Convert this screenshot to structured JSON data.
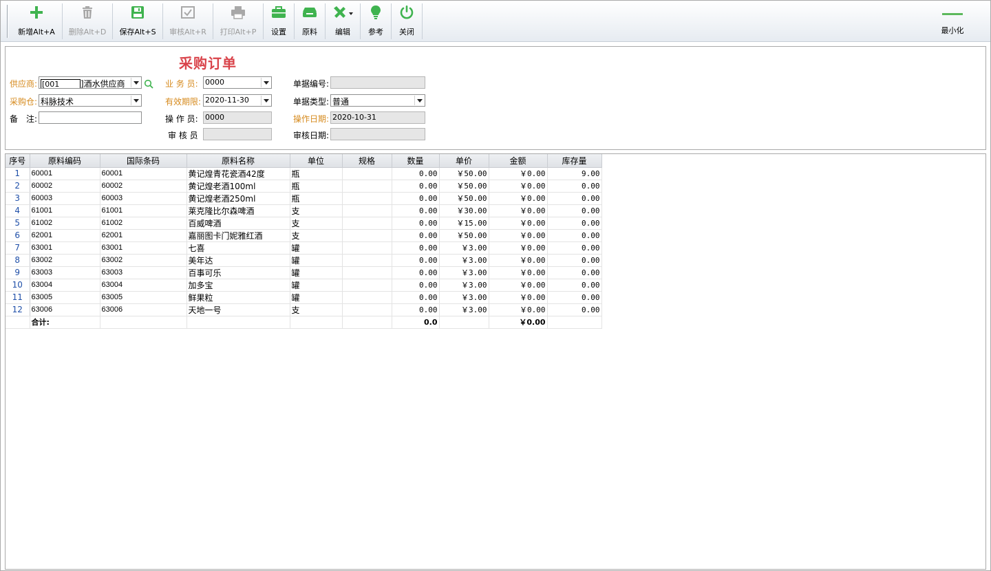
{
  "toolbar": {
    "buttons": [
      {
        "label": "新增Alt+A",
        "icon": "plus-icon",
        "enabled": true
      },
      {
        "label": "删除Alt+D",
        "icon": "trash-icon",
        "enabled": false
      },
      {
        "label": "保存Alt+S",
        "icon": "save-icon",
        "enabled": true
      },
      {
        "label": "审核Alt+R",
        "icon": "approve-icon",
        "enabled": false
      },
      {
        "label": "打印Alt+P",
        "icon": "printer-icon",
        "enabled": false
      },
      {
        "label": "设置",
        "icon": "briefcase-icon",
        "enabled": true
      },
      {
        "label": "原料",
        "icon": "material-icon",
        "enabled": true
      },
      {
        "label": "编辑",
        "icon": "tools-icon",
        "enabled": true
      },
      {
        "label": "参考",
        "icon": "lightbulb-icon",
        "enabled": true
      },
      {
        "label": "关闭",
        "icon": "power-icon",
        "enabled": true
      }
    ],
    "minimize_label": "最小化",
    "icon_color": "#3fb34f"
  },
  "form": {
    "title": "采购订单",
    "supplier": {
      "label": "供应商:",
      "code": "[001",
      "name": "]酒水供应商"
    },
    "warehouse": {
      "label": "采购仓:",
      "value": "科脉技术"
    },
    "remark": {
      "label": "备　注:",
      "value": ""
    },
    "salesman": {
      "label": "业 务 员:",
      "value": "0000"
    },
    "valid_until": {
      "label": "有效期限:",
      "value": "2020-11-30"
    },
    "operator": {
      "label": "操 作 员:",
      "value": "0000"
    },
    "auditor": {
      "label": "审 核 员",
      "value": ""
    },
    "doc_no": {
      "label": "单据编号:",
      "value": ""
    },
    "doc_type": {
      "label": "单据类型:",
      "value": "普通"
    },
    "op_date": {
      "label": "操作日期:",
      "value": "2020-10-31"
    },
    "audit_date": {
      "label": "审核日期:",
      "value": ""
    },
    "required_color": "#d68a1d",
    "title_color": "#d9434a"
  },
  "grid": {
    "columns": [
      "序号",
      "原料编码",
      "国际条码",
      "原料名称",
      "单位",
      "规格",
      "数量",
      "单价",
      "金额",
      "库存量"
    ],
    "rows": [
      {
        "seq": "1",
        "code": "60001",
        "barcode": "60001",
        "name": "黄记煌青花瓷酒42度",
        "unit": "瓶",
        "spec": "",
        "qty": "0.00",
        "price": "￥50.00",
        "amount": "￥0.00",
        "stock": "9.00"
      },
      {
        "seq": "2",
        "code": "60002",
        "barcode": "60002",
        "name": "黄记煌老酒100ml",
        "unit": "瓶",
        "spec": "",
        "qty": "0.00",
        "price": "￥50.00",
        "amount": "￥0.00",
        "stock": "0.00"
      },
      {
        "seq": "3",
        "code": "60003",
        "barcode": "60003",
        "name": "黄记煌老酒250ml",
        "unit": "瓶",
        "spec": "",
        "qty": "0.00",
        "price": "￥50.00",
        "amount": "￥0.00",
        "stock": "0.00"
      },
      {
        "seq": "4",
        "code": "61001",
        "barcode": "61001",
        "name": "莱克隆比尔森啤酒",
        "unit": "支",
        "spec": "",
        "qty": "0.00",
        "price": "￥30.00",
        "amount": "￥0.00",
        "stock": "0.00"
      },
      {
        "seq": "5",
        "code": "61002",
        "barcode": "61002",
        "name": "百威啤酒",
        "unit": "支",
        "spec": "",
        "qty": "0.00",
        "price": "￥15.00",
        "amount": "￥0.00",
        "stock": "0.00"
      },
      {
        "seq": "6",
        "code": "62001",
        "barcode": "62001",
        "name": "嘉丽图卡门妮雅红酒",
        "unit": "支",
        "spec": "",
        "qty": "0.00",
        "price": "￥50.00",
        "amount": "￥0.00",
        "stock": "0.00"
      },
      {
        "seq": "7",
        "code": "63001",
        "barcode": "63001",
        "name": "七喜",
        "unit": "罐",
        "spec": "",
        "qty": "0.00",
        "price": "￥3.00",
        "amount": "￥0.00",
        "stock": "0.00"
      },
      {
        "seq": "8",
        "code": "63002",
        "barcode": "63002",
        "name": "美年达",
        "unit": "罐",
        "spec": "",
        "qty": "0.00",
        "price": "￥3.00",
        "amount": "￥0.00",
        "stock": "0.00"
      },
      {
        "seq": "9",
        "code": "63003",
        "barcode": "63003",
        "name": "百事可乐",
        "unit": "罐",
        "spec": "",
        "qty": "0.00",
        "price": "￥3.00",
        "amount": "￥0.00",
        "stock": "0.00"
      },
      {
        "seq": "10",
        "code": "63004",
        "barcode": "63004",
        "name": "加多宝",
        "unit": "罐",
        "spec": "",
        "qty": "0.00",
        "price": "￥3.00",
        "amount": "￥0.00",
        "stock": "0.00"
      },
      {
        "seq": "11",
        "code": "63005",
        "barcode": "63005",
        "name": "鲜果粒",
        "unit": "罐",
        "spec": "",
        "qty": "0.00",
        "price": "￥3.00",
        "amount": "￥0.00",
        "stock": "0.00"
      },
      {
        "seq": "12",
        "code": "63006",
        "barcode": "63006",
        "name": "天地一号",
        "unit": "支",
        "spec": "",
        "qty": "0.00",
        "price": "￥3.00",
        "amount": "￥0.00",
        "stock": "0.00"
      }
    ],
    "total": {
      "label": "合计:",
      "qty": "0.0",
      "amount": "￥0.00"
    }
  }
}
